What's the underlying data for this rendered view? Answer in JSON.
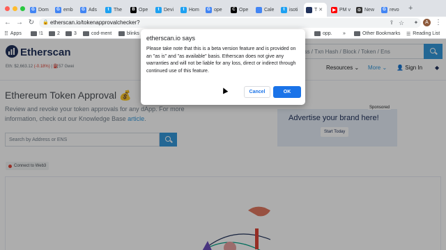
{
  "browser": {
    "tabs": [
      {
        "label": "Dom",
        "icon": "google-icon",
        "color": "#4285f4",
        "glyph": "G"
      },
      {
        "label": "emb",
        "icon": "google-icon",
        "color": "#4285f4",
        "glyph": "G"
      },
      {
        "label": "Ads",
        "icon": "google-icon",
        "color": "#4285f4",
        "glyph": "G"
      },
      {
        "label": "The",
        "icon": "twitter-icon",
        "color": "#1da1f2",
        "glyph": "t"
      },
      {
        "label": "Ope",
        "icon": "b-icon",
        "color": "#000000",
        "glyph": "B"
      },
      {
        "label": "Devi",
        "icon": "twitter-icon",
        "color": "#1da1f2",
        "glyph": "t"
      },
      {
        "label": "Hom",
        "icon": "twitter-icon",
        "color": "#1da1f2",
        "glyph": "t"
      },
      {
        "label": "ope",
        "icon": "google-icon",
        "color": "#4285f4",
        "glyph": "G"
      },
      {
        "label": "Ope",
        "icon": "c-icon",
        "color": "#000000",
        "glyph": "C"
      },
      {
        "label": "Cale",
        "icon": "calendar-icon",
        "color": "#4285f4",
        "glyph": ""
      },
      {
        "label": "isoti",
        "icon": "twitter-icon",
        "color": "#1da1f2",
        "glyph": "t"
      },
      {
        "label": "T",
        "icon": "etherscan-icon",
        "color": "#21325b",
        "glyph": ""
      },
      {
        "label": "PM v",
        "icon": "youtube-icon",
        "color": "#ff0000",
        "glyph": "▶"
      },
      {
        "label": "New",
        "icon": "github-icon",
        "color": "#333333",
        "glyph": "⊙"
      },
      {
        "label": "revo",
        "icon": "google-icon",
        "color": "#4285f4",
        "glyph": "G"
      }
    ],
    "new_tab": "+",
    "url": "etherscan.io/tokenapprovalchecker?",
    "bookmarks": [
      "Apps",
      "!1",
      "2",
      "3",
      "cod-ment",
      "blinks",
      "opp.",
      "»",
      "Other Bookmarks",
      "Reading List"
    ],
    "avatar_letter": "A"
  },
  "site": {
    "logo": "Etherscan",
    "eth_price": "Eth: $2,663.12",
    "eth_change": "(-0.18%)",
    "gas": "| ⛽57 Gwei",
    "search_placeholder": "dress / Txn Hash / Block / Token / Ens",
    "nav": [
      "Resources ⌄",
      "More ⌄",
      "Sign In"
    ],
    "title": "Ethereum Token Approval 💰",
    "subtitle": "Review and revoke your token approvals for any dApp. For more information, check out our Knowledge Base",
    "subtitle_link": "article",
    "subtitle_end": ".",
    "address_placeholder": "Search by Address or ENS",
    "connect": "Connect to Web3",
    "ad_sponsored": "Sponsored",
    "ad_text": "Advertise your brand here!",
    "ad_button": "Start Today"
  },
  "dialog": {
    "title": "etherscan.io says",
    "message": "Please take note that this is a beta version feature and is provided on an \"as is\" and \"as available\" basis. Etherscan does not give any warranties and will not be liable for any loss, direct or indirect through continued use of this feature.",
    "cancel": "Cancel",
    "ok": "OK"
  }
}
